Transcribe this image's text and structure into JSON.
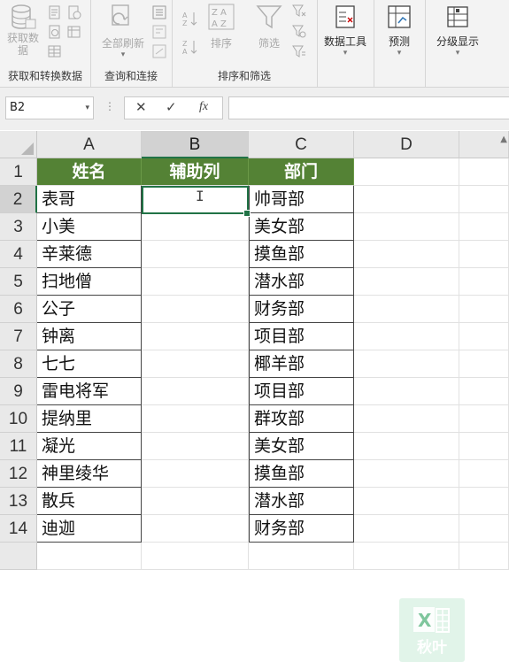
{
  "ribbon": {
    "groups": [
      {
        "label": "获取和转换数据",
        "buttons": [
          "获取数\n据"
        ]
      },
      {
        "label": "查询和连接",
        "buttons": [
          "全部刷新"
        ]
      },
      {
        "label": "排序和筛选",
        "buttons": [
          "排序",
          "筛选"
        ]
      },
      {
        "label": "",
        "buttons": [
          "数据工具"
        ]
      },
      {
        "label": "",
        "buttons": [
          "预测"
        ]
      },
      {
        "label": "",
        "buttons": [
          "分级显示"
        ]
      }
    ]
  },
  "formula_bar": {
    "name_box": "B2",
    "cancel_icon": "✕",
    "enter_icon": "✓",
    "fx_label": "fx",
    "formula": ""
  },
  "columns": [
    "A",
    "B",
    "C",
    "D"
  ],
  "rows": [
    "1",
    "2",
    "3",
    "4",
    "5",
    "6",
    "7",
    "8",
    "9",
    "10",
    "11",
    "12",
    "13",
    "14"
  ],
  "header_row": [
    "姓名",
    "辅助列",
    "部门"
  ],
  "data_rows": [
    [
      "表哥",
      "",
      "帅哥部"
    ],
    [
      "小美",
      "",
      "美女部"
    ],
    [
      "辛莱德",
      "",
      "摸鱼部"
    ],
    [
      "扫地僧",
      "",
      "潜水部"
    ],
    [
      "公子",
      "",
      "财务部"
    ],
    [
      "钟离",
      "",
      "项目部"
    ],
    [
      "七七",
      "",
      "椰羊部"
    ],
    [
      "雷电将军",
      "",
      "项目部"
    ],
    [
      "提纳里",
      "",
      "群攻部"
    ],
    [
      "凝光",
      "",
      "美女部"
    ],
    [
      "神里绫华",
      "",
      "摸鱼部"
    ],
    [
      "散兵",
      "",
      "潜水部"
    ],
    [
      "迪迦",
      "",
      "财务部"
    ]
  ],
  "active_cell": "B2",
  "watermark": "秋叶",
  "colors": {
    "header_fill": "#548235",
    "accent": "#217346"
  }
}
